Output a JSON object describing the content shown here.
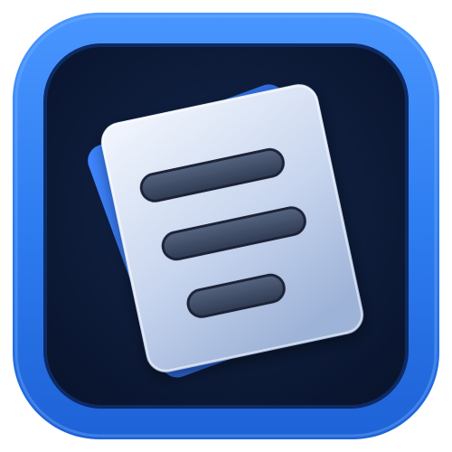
{
  "app_icon": {
    "icon": "document-lines-icon",
    "colors": {
      "outer_frame": "#2d7cf0",
      "outer_frame_edge": "#1f5fd0",
      "inner_tile": "#0b1630",
      "inner_tile_glow": "#1a2f55",
      "back_sheet": "#2f6fe6",
      "front_sheet_top": "#dfe8f8",
      "front_sheet_bottom": "#9fb4d6",
      "line_fill": "#3c4b66",
      "line_stroke": "#1b2438"
    },
    "text_lines_shown": 3
  }
}
